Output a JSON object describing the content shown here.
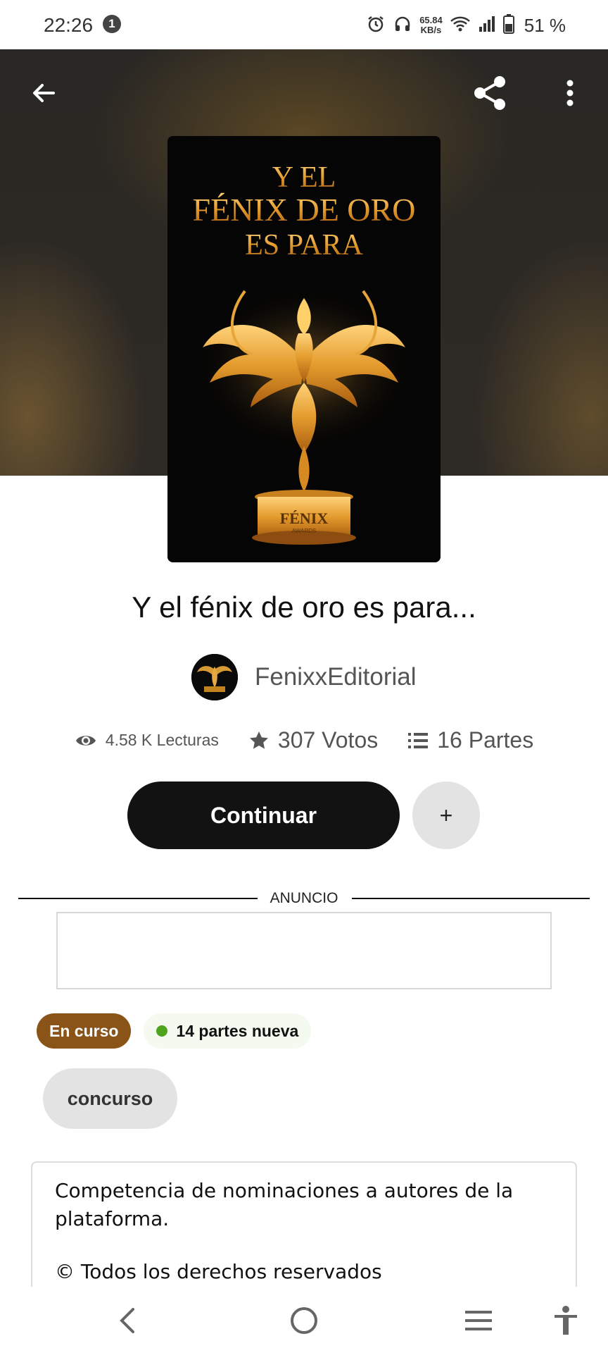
{
  "status_bar": {
    "time": "22:26",
    "notification_count": "1",
    "speed_value": "65.84",
    "speed_unit": "KB/s",
    "battery": "51 %"
  },
  "book": {
    "title": "Y el fénix de oro es para...",
    "author": "FenixxEditorial",
    "cover": {
      "title_lines": [
        "Y EL",
        "FÉNIX DE ORO",
        "ES PARA"
      ],
      "award_name": "FÉNIX",
      "award_sub": "AWARDS"
    }
  },
  "stats": {
    "reads": "4.58 K Lecturas",
    "votes": "307 Votos",
    "parts": "16 Partes"
  },
  "actions": {
    "continue_label": "Continuar",
    "add_label": "+"
  },
  "ad": {
    "label": "ANUNCIO"
  },
  "badges": {
    "status": "En curso",
    "new_parts": "14 partes nueva"
  },
  "tags": [
    "concurso"
  ],
  "description": {
    "text": "Competencia de nominaciones a autores de la plataforma.",
    "rights": "© Todos los derechos reservados"
  },
  "colors": {
    "status_badge": "#8a5317",
    "new_dot": "#4ea41c",
    "primary_button": "#121212"
  }
}
